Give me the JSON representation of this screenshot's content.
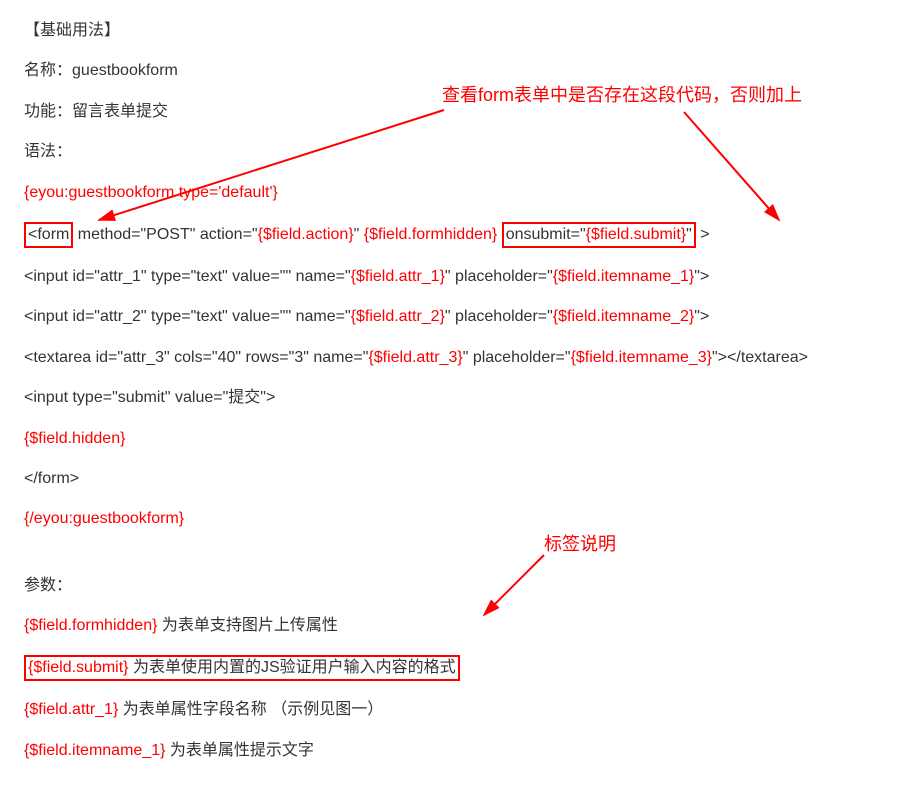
{
  "section_header": "【基础用法】",
  "name_label": "名称：",
  "name_value": "guestbookform",
  "func_label": "功能：",
  "func_value": "留言表单提交",
  "syntax_label": "语法：",
  "note1": "查看form表单中是否存在这段代码，否则加上",
  "code": {
    "l1": "{eyou:guestbookform type='default'}",
    "l2_a": "<form",
    "l2_b": " method=\"POST\" action=\"",
    "l2_c": "{$field.action}",
    "l2_d": "\"  ",
    "l2_e": "{$field.formhidden}",
    "l2_f": " ",
    "l2_g_pre": "onsubmit=\"",
    "l2_g_var": "{$field.submit}",
    "l2_g_post": "\"",
    "l2_h": " >",
    "l3_a": "<input id=\"attr_1\" type=\"text\" value=\"\" name=\"",
    "l3_b": "{$field.attr_1}",
    "l3_c": "\" placeholder=\"",
    "l3_d": "{$field.itemname_1}",
    "l3_e": "\">",
    "l4_a": "<input id=\"attr_2\" type=\"text\" value=\"\" name=\"",
    "l4_b": "{$field.attr_2}",
    "l4_c": "\" placeholder=\"",
    "l4_d": "{$field.itemname_2}",
    "l4_e": "\">",
    "l5_a": "<textarea id=\"attr_3\" cols=\"40\" rows=\"3\" name=\"",
    "l5_b": "{$field.attr_3}",
    "l5_c": "\" placeholder=\"",
    "l5_d": "{$field.itemname_3}",
    "l5_e": "\"></textarea>",
    "l6": "<input type=\"submit\" value=\"提交\">",
    "l7": "{$field.hidden}",
    "l8": "</form>",
    "l9": "{/eyou:guestbookform}"
  },
  "params_label": "参数：",
  "note2": "标签说明",
  "params": {
    "p1_var": "{$field.formhidden}",
    "p1_text": " 为表单支持图片上传属性",
    "p2_var": "{$field.submit}",
    "p2_text": " 为表单使用内置的JS验证用户输入内容的格式",
    "p3_var": "{$field.attr_1}",
    "p3_text": " 为表单属性字段名称 （示例见图一）",
    "p4_var": "{$field.itemname_1}",
    "p4_text": " 为表单属性提示文字"
  }
}
